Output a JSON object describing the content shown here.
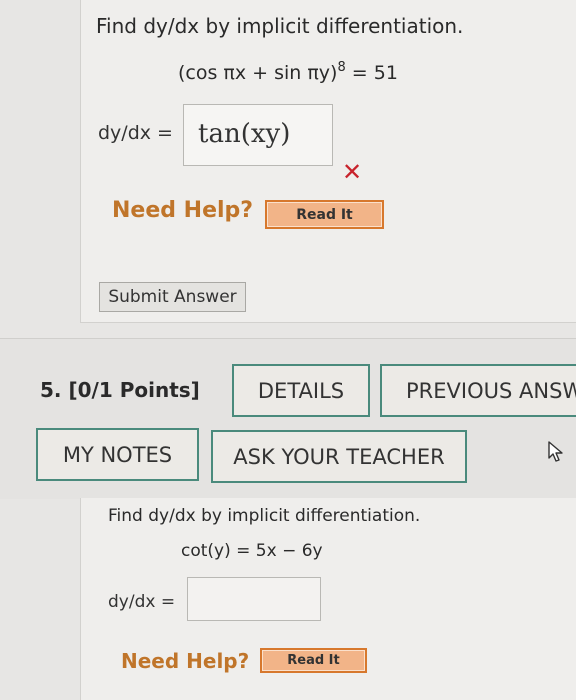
{
  "question4": {
    "prompt": "Find dy/dx by implicit differentiation.",
    "equation_base": "(cos πx + sin πy)",
    "equation_exp": "8",
    "equation_rhs": " = 51",
    "answer_label": "dy/dx =",
    "answer_value": "tan(xy)",
    "incorrect_mark": "✕",
    "need_help_label": "Need Help?",
    "read_it_label": "Read It",
    "submit_label": "Submit Answer"
  },
  "question5": {
    "points_label": "5. [0/1 Points]",
    "details_label": "DETAILS",
    "previous_answers_label": "PREVIOUS ANSW",
    "my_notes_label": "MY NOTES",
    "ask_teacher_label": "ASK YOUR TEACHER",
    "prompt": "Find dy/dx by implicit differentiation.",
    "equation": "cot(y) = 5x − 6y",
    "answer_label": "dy/dx =",
    "answer_value": "",
    "need_help_label": "Need Help?",
    "read_it_label": "Read It"
  },
  "colors": {
    "accent_teal": "#4a8a7c",
    "need_help_orange": "#c0752a",
    "read_it_fill": "#f2b488",
    "incorrect_red": "#c8232c"
  },
  "icons": {
    "cursor": "mouse-pointer-icon"
  }
}
